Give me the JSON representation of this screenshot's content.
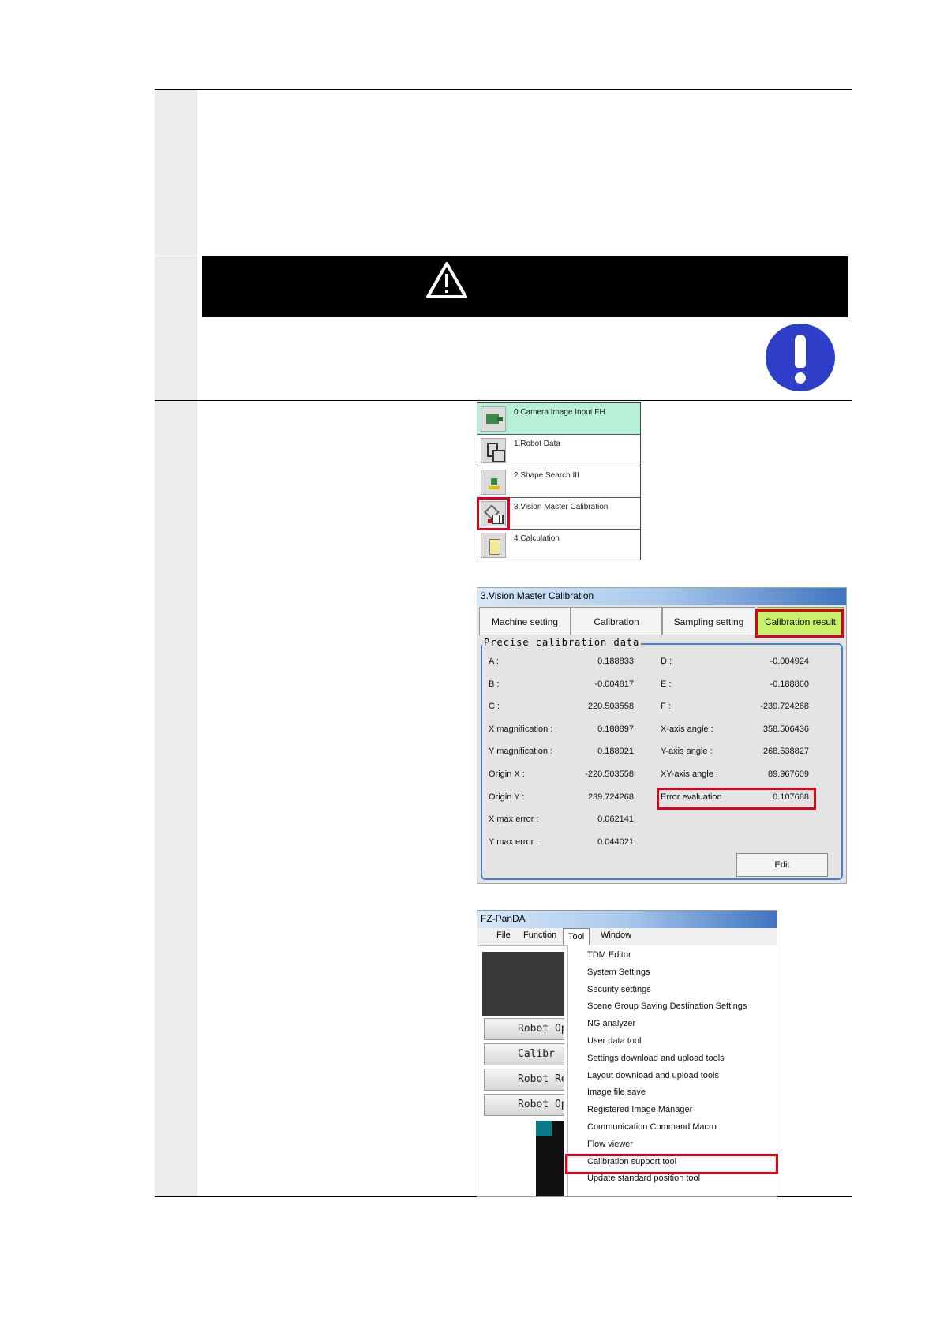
{
  "flow": {
    "items": [
      {
        "label": "0.Camera Image Input FH",
        "icon": "camera-icon"
      },
      {
        "label": "1.Robot Data",
        "icon": "robot-icon"
      },
      {
        "label": "2.Shape Search III",
        "icon": "shape-search-icon"
      },
      {
        "label": "3.Vision Master Calibration",
        "icon": "calibration-icon"
      },
      {
        "label": "4.Calculation",
        "icon": "calculator-icon"
      }
    ]
  },
  "calibration": {
    "title": "3.Vision Master Calibration",
    "tabs": [
      "Machine setting",
      "Calibration",
      "Sampling setting",
      "Calibration result"
    ],
    "frame_title": "Precise calibration data",
    "left_rows": [
      {
        "label": "A :",
        "value": "0.188833"
      },
      {
        "label": "B :",
        "value": "-0.004817"
      },
      {
        "label": "C :",
        "value": "220.503558"
      },
      {
        "label": "X magnification :",
        "value": "0.188897"
      },
      {
        "label": "Y magnification :",
        "value": "0.188921"
      },
      {
        "label": "Origin X :",
        "value": "-220.503558"
      },
      {
        "label": "Origin Y :",
        "value": "239.724268"
      },
      {
        "label": "X max error :",
        "value": "0.062141"
      },
      {
        "label": "Y max error :",
        "value": "0.044021"
      }
    ],
    "right_rows": [
      {
        "label": "D :",
        "value": "-0.004924"
      },
      {
        "label": "E :",
        "value": "-0.188860"
      },
      {
        "label": "F :",
        "value": "-239.724268"
      },
      {
        "label": "X-axis angle :",
        "value": "358.506436"
      },
      {
        "label": "Y-axis angle :",
        "value": "268.538827"
      },
      {
        "label": "XY-axis angle :",
        "value": "89.967609"
      },
      {
        "label": "Error evaluation",
        "value": "0.107688"
      }
    ],
    "edit_label": "Edit"
  },
  "fz": {
    "title": "FZ-PanDA",
    "menus": [
      "File",
      "Function",
      "Tool",
      "Window"
    ],
    "left_buttons": [
      "Robot Op",
      "Calibr",
      "Robot Ref.",
      "Robot Opera"
    ],
    "tool_items": [
      "TDM Editor",
      "System Settings",
      "Security settings",
      "Scene Group Saving Destination Settings",
      "NG analyzer",
      "User data tool",
      "Settings download and upload tools",
      "Layout download and upload tools",
      "Image file save",
      "Registered Image Manager",
      "Communication Command Macro",
      "Flow viewer",
      "Calibration support tool",
      "Update standard position tool"
    ]
  },
  "colors": {
    "highlight": "#e0001a",
    "selected_tab": "#c8f06a",
    "active_flow": "#b7f0d8",
    "caution_circle": "#2f3ec8"
  }
}
